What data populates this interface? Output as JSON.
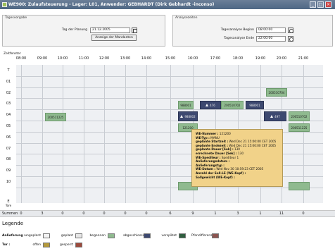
{
  "window": {
    "title": "WE900: Zulaufsteuerung - Lager: L01, Anwender: GEBHARDT (Dirk Gebhardt -inconso)",
    "minimize": "_",
    "maximize": "□",
    "close": "×"
  },
  "tagesvorgabe": {
    "title": "Tagesvorgabe",
    "tag_label": "Tag der Planung",
    "tag_value": "21.12.2005",
    "button_label": "Anzeige der Mandanten"
  },
  "analysezeiten": {
    "title": "Analysezeiten",
    "begin_label": "Tagesanalyse Beginn",
    "begin_value": "08:00:00",
    "end_label": "Tagesanalyse Ende",
    "end_value": "22:00:00"
  },
  "grid": {
    "zeitfenster_label": "Zeitfenster",
    "hours": [
      "08:00",
      "09:00",
      "10:00",
      "11:00",
      "12:00",
      "13:00",
      "14:00",
      "15:00",
      "16:00",
      "17:00",
      "18:00",
      "19:00",
      "20:00",
      "21:00"
    ],
    "rows": [
      "T",
      "01",
      "02",
      "03",
      "04",
      "05",
      "06",
      "07",
      "08",
      "09",
      "10"
    ],
    "last_row_line1": "E",
    "last_row_line2": "Tore"
  },
  "bars": [
    {
      "label": "200511225",
      "kind": "green"
    },
    {
      "label": "988001",
      "kind": "green"
    },
    {
      "label": "476",
      "kind": "navy"
    },
    {
      "label": "200510702",
      "kind": "green"
    },
    {
      "label": "988001",
      "kind": "navy"
    },
    {
      "label": "200510704",
      "kind": "green"
    },
    {
      "label": "988002",
      "kind": "navy"
    },
    {
      "label": "497",
      "kind": "navy"
    },
    {
      "label": "200510702",
      "kind": "green"
    },
    {
      "label": "121200",
      "kind": "green"
    },
    {
      "label": "200511225",
      "kind": "green"
    }
  ],
  "tooltip": {
    "lines": [
      {
        "label": "WE-Nummer :",
        "value": " 121200"
      },
      {
        "label": "WE-Typ :",
        "value": " MANU"
      },
      {
        "label": "geplante Startzeit :",
        "value": " Wed Dec 21 15:00:00 CET 2005"
      },
      {
        "label": "geplante Endezeit :",
        "value": " Wed Dec 21 15:00:00 CET 2005"
      },
      {
        "label": "geplante Dauer [Sek] :",
        "value": " 130"
      },
      {
        "label": "errechnete Dauer [Sek] :",
        "value": " 130"
      },
      {
        "label": "WE-Spediteur :",
        "value": " Spediteur 1"
      },
      {
        "label": "Anlieferungsdatum :",
        "value": ""
      },
      {
        "label": "Anlieferungstyp :",
        "value": ""
      },
      {
        "label": "WE-Datum :",
        "value": " Wed Nov 30 10:59:23 CET 2005"
      },
      {
        "label": "Anzahl der Soll-LE (WE-Kopf) :",
        "value": ""
      },
      {
        "label": "Sollgewicht (WE-Kopf) :",
        "value": ""
      }
    ]
  },
  "summen": {
    "label": "Summen",
    "values": [
      "0",
      "3",
      "0",
      "0",
      "0",
      "0",
      "0",
      "6",
      "9",
      "1",
      "3",
      "1",
      "11",
      "0"
    ]
  },
  "legende": {
    "title": "Legende",
    "anlieferung_label": "Anlieferung :",
    "anlieferung_items": [
      {
        "text": "ungeplant",
        "color": "#f4f4f4"
      },
      {
        "text": "geplant",
        "color": "#e6e6e6"
      },
      {
        "text": "begonnen",
        "color": "#8fba8f"
      },
      {
        "text": "abgeschlossen",
        "color": "#3d4970"
      },
      {
        "text": "verspätet",
        "color": "#2f5e3f"
      },
      {
        "text": "Pfandifferenz",
        "color": "#8c5450"
      }
    ],
    "tor_label": "Tor :",
    "tor_items": [
      {
        "text": "offen",
        "color": "#b59a3c"
      },
      {
        "text": "gesperrt",
        "color": "#9c4a3c"
      }
    ]
  },
  "colors": {
    "titlebar": "#5a7290",
    "tooltip_bg": "#f1d289",
    "bar_green": "#8fba8f",
    "bar_navy": "#3d4970"
  }
}
